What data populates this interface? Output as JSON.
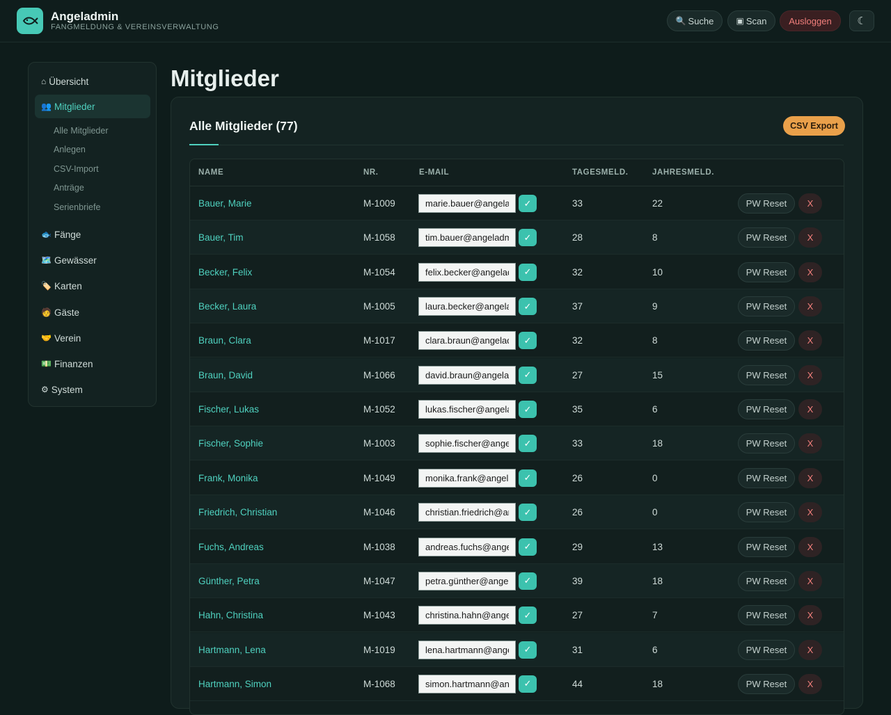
{
  "header": {
    "title": "Angeladmin",
    "subtitle": "Fangmeldung & Vereinsverwaltung",
    "search_label": "Suche",
    "scan_label": "Scan",
    "logout_label": "Ausloggen",
    "theme_toggle": "☾",
    "search_icon": "🔍",
    "scan_icon": "▣"
  },
  "sidebar": {
    "overview": {
      "icon": "⌂",
      "label": "Übersicht"
    },
    "members": {
      "icon": "👥",
      "label": "Mitglieder"
    },
    "sub": [
      "Alle Mitglieder",
      "Anlegen",
      "CSV-Import",
      "Anträge",
      "Serienbriefe"
    ],
    "items": [
      {
        "icon": "🐟",
        "label": "Fänge"
      },
      {
        "icon": "🗺️",
        "label": "Gewässer"
      },
      {
        "icon": "🏷️",
        "label": "Karten"
      },
      {
        "icon": "🧑",
        "label": "Gäste"
      },
      {
        "icon": "🤝",
        "label": "Verein"
      },
      {
        "icon": "💵",
        "label": "Finanzen"
      },
      {
        "icon": "⚙",
        "label": "System"
      }
    ]
  },
  "main": {
    "page_title": "Mitglieder",
    "card_title": "Alle Mitglieder (77)",
    "csv_export": "CSV Export",
    "columns": [
      "Name",
      "Nr.",
      "E-Mail",
      "Tagesmeld.",
      "Jahresmeld."
    ],
    "pw_reset_label": "PW Reset",
    "delete_label": "X",
    "confirm_label": "✓",
    "rows": [
      {
        "name": "Bauer, Marie",
        "nr": "M-1009",
        "email": "marie.bauer@angeladmin.de",
        "tages": "33",
        "jahres": "22"
      },
      {
        "name": "Bauer, Tim",
        "nr": "M-1058",
        "email": "tim.bauer@angeladmin.de",
        "tages": "28",
        "jahres": "8"
      },
      {
        "name": "Becker, Felix",
        "nr": "M-1054",
        "email": "felix.becker@angeladmin.de",
        "tages": "32",
        "jahres": "10"
      },
      {
        "name": "Becker, Laura",
        "nr": "M-1005",
        "email": "laura.becker@angeladmin.de",
        "tages": "37",
        "jahres": "9"
      },
      {
        "name": "Braun, Clara",
        "nr": "M-1017",
        "email": "clara.braun@angeladmin.de",
        "tages": "32",
        "jahres": "8"
      },
      {
        "name": "Braun, David",
        "nr": "M-1066",
        "email": "david.braun@angeladmin.de",
        "tages": "27",
        "jahres": "15"
      },
      {
        "name": "Fischer, Lukas",
        "nr": "M-1052",
        "email": "lukas.fischer@angeladmin.de",
        "tages": "35",
        "jahres": "6"
      },
      {
        "name": "Fischer, Sophie",
        "nr": "M-1003",
        "email": "sophie.fischer@angeladmin.de",
        "tages": "33",
        "jahres": "18"
      },
      {
        "name": "Frank, Monika",
        "nr": "M-1049",
        "email": "monika.frank@angeladmin.de",
        "tages": "26",
        "jahres": "0"
      },
      {
        "name": "Friedrich, Christian",
        "nr": "M-1046",
        "email": "christian.friedrich@angeladmin.de",
        "tages": "26",
        "jahres": "0"
      },
      {
        "name": "Fuchs, Andreas",
        "nr": "M-1038",
        "email": "andreas.fuchs@angeladmin.de",
        "tages": "29",
        "jahres": "13"
      },
      {
        "name": "Günther, Petra",
        "nr": "M-1047",
        "email": "petra.günther@angeladmin.de",
        "tages": "39",
        "jahres": "18"
      },
      {
        "name": "Hahn, Christina",
        "nr": "M-1043",
        "email": "christina.hahn@angeladmin.de",
        "tages": "27",
        "jahres": "7"
      },
      {
        "name": "Hartmann, Lena",
        "nr": "M-1019",
        "email": "lena.hartmann@angeladmin.de",
        "tages": "31",
        "jahres": "6"
      },
      {
        "name": "Hartmann, Simon",
        "nr": "M-1068",
        "email": "simon.hartmann@angeladmin.de",
        "tages": "44",
        "jahres": "18"
      }
    ]
  }
}
